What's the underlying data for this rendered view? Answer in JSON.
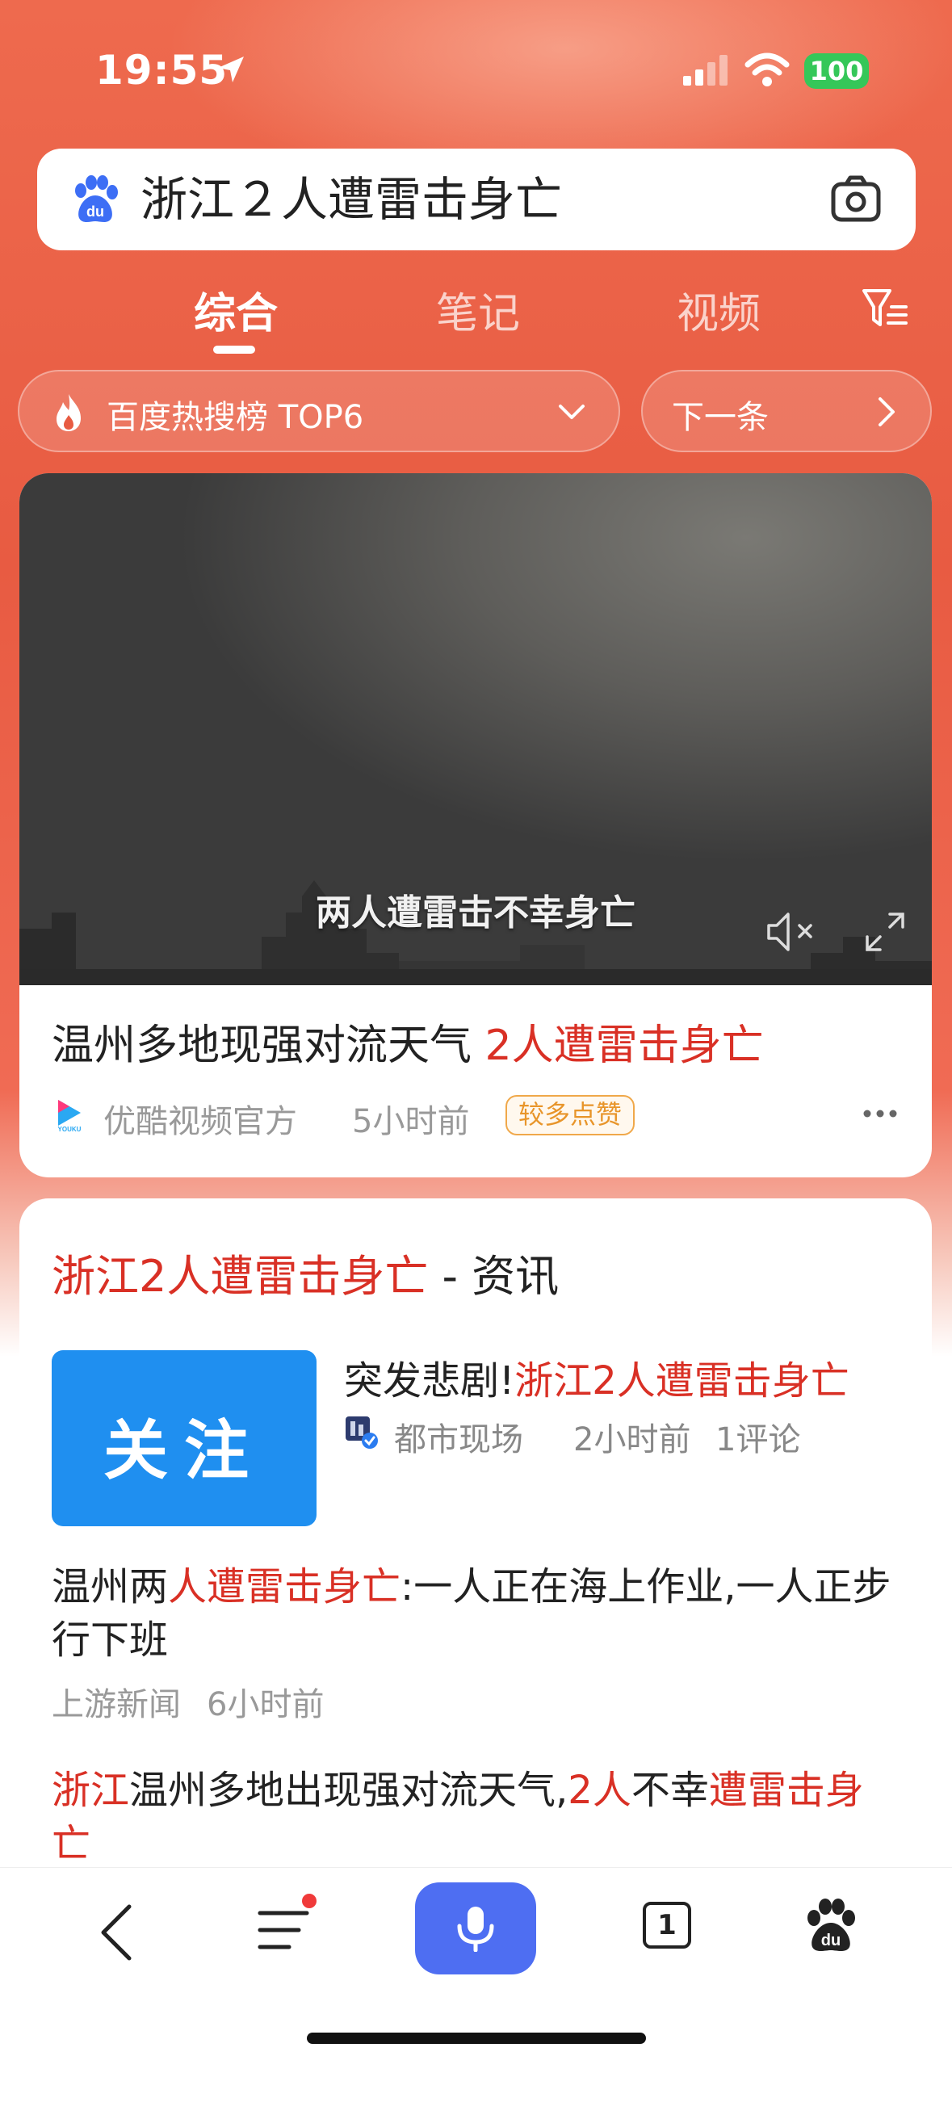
{
  "status_bar": {
    "time": "19:55",
    "battery": "100",
    "battery_color": "#35c759"
  },
  "search": {
    "query": "浙江２人遭雷击身亡",
    "logo_icon": "baidu-paw-logo",
    "camera_icon": "camera-icon"
  },
  "tabs": [
    {
      "label": "综合",
      "active": true
    },
    {
      "label": "笔记",
      "active": false
    },
    {
      "label": "视频",
      "active": false
    }
  ],
  "hot_bar": {
    "label": "百度热搜榜 TOP6",
    "next_label": "下一条"
  },
  "video_result": {
    "subtitle": "两人遭雷击不幸身亡",
    "title_plain": "温州多地现强对流天气 ",
    "title_highlight": "2人遭雷击身亡",
    "source": "优酷视频官方",
    "age": "5小时前",
    "badge": "较多点赞",
    "logo_text": "YOUKU"
  },
  "news_section": {
    "heading_highlight": "浙江2人遭雷击身亡",
    "heading_suffix": " - 资讯",
    "thumb_text": "关注",
    "item1": {
      "title_plain": "突发悲剧!",
      "title_highlight": "浙江2人遭雷击身亡",
      "source": "都市现场",
      "age": "2小时前",
      "comments": "1评论"
    },
    "item2": {
      "part1": "温州两",
      "part2_highlight": "人遭雷击身亡",
      "part3": ":一人正在海上作业,一人正步行下班",
      "source": "上游新闻",
      "age": "6小时前"
    },
    "item3": {
      "part1_highlight": "浙江",
      "part2": "温州多地出现强对流天气,",
      "part3_highlight": "2人",
      "part4": "不幸",
      "part5_highlight": "遭雷击身亡"
    }
  },
  "toolbar": {
    "tab_count": "1",
    "accent_color": "#4e6ef2"
  },
  "colors": {
    "highlight_red": "#d93025",
    "header_orange": "#e85b42"
  }
}
